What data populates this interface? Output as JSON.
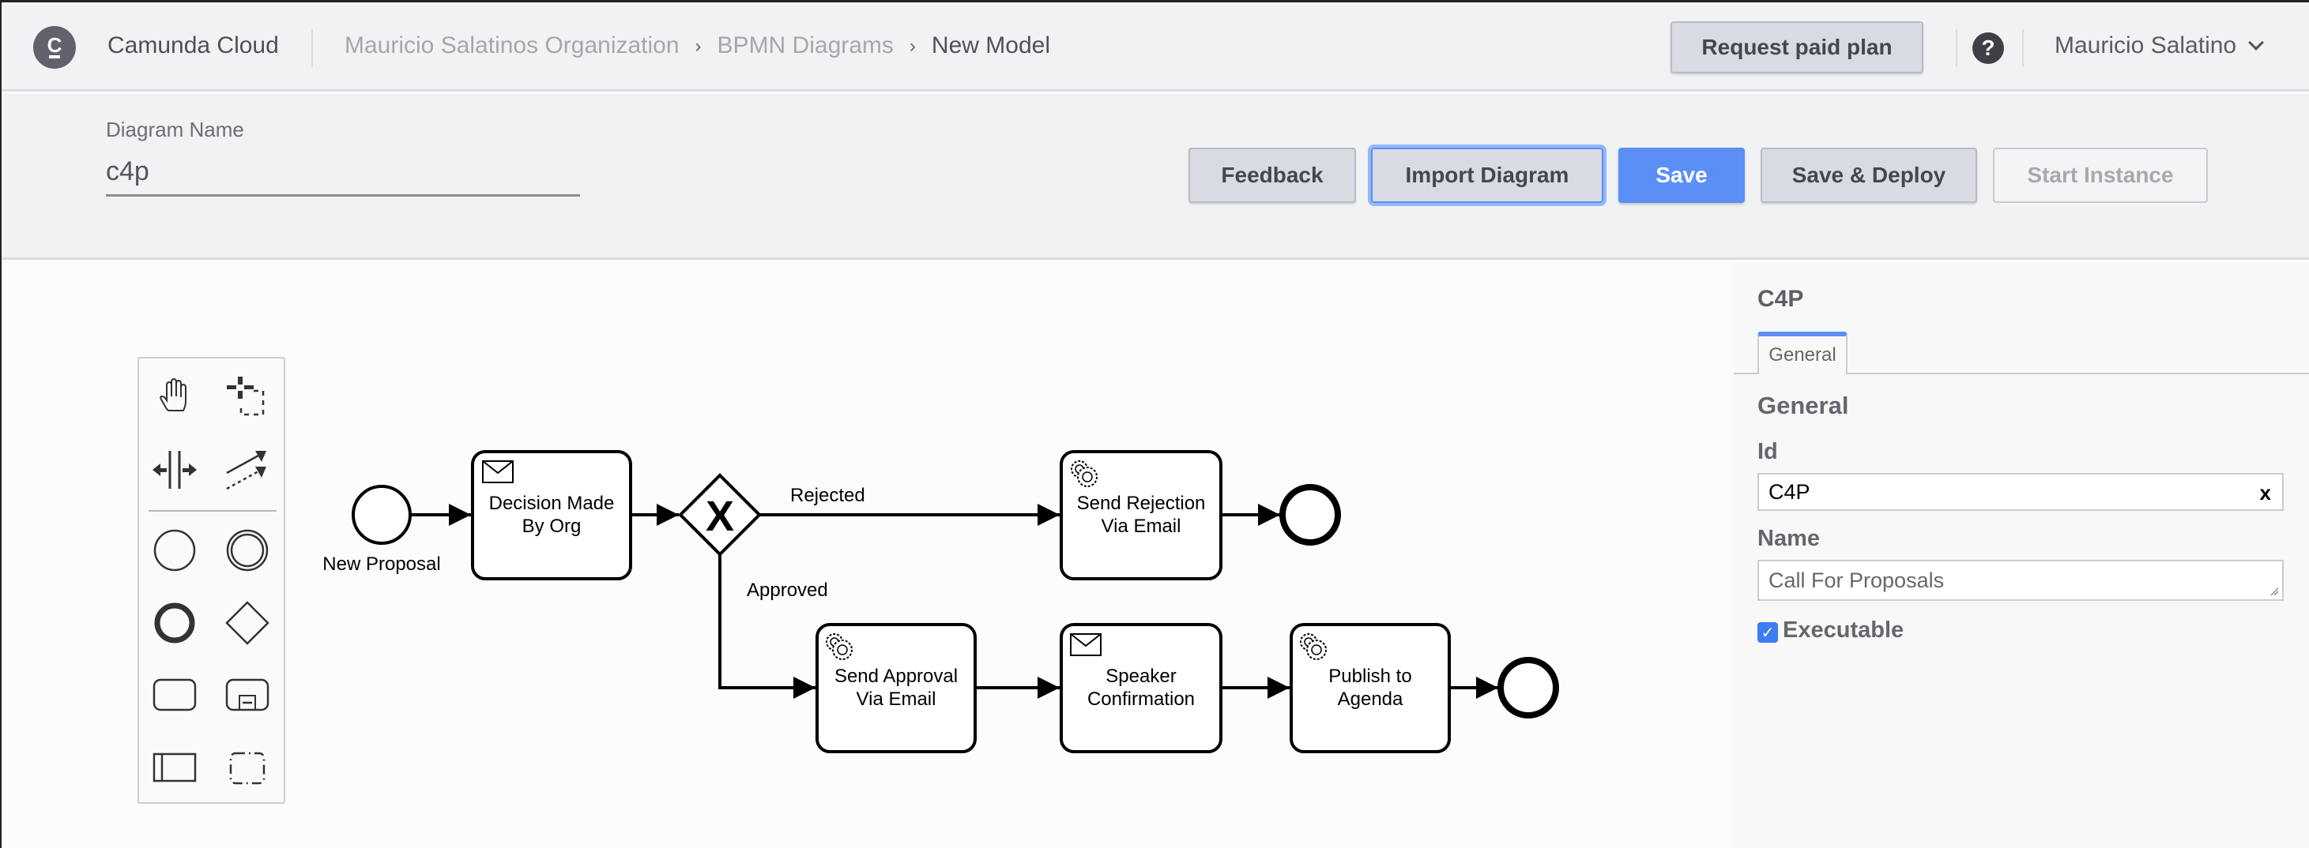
{
  "topnav": {
    "logo_letter": "C",
    "brand": "Camunda Cloud",
    "breadcrumbs": [
      "Mauricio Salatinos Organization",
      "BPMN Diagrams",
      "New Model"
    ],
    "breadcrumb_separator": "›",
    "request_plan_label": "Request paid plan",
    "help_icon": "?",
    "user_name": "Mauricio Salatino"
  },
  "toolbar": {
    "diagram_name_label": "Diagram Name",
    "diagram_name_value": "c4p",
    "buttons": {
      "feedback": "Feedback",
      "import": "Import Diagram",
      "save": "Save",
      "save_deploy": "Save & Deploy",
      "start_instance": "Start Instance"
    }
  },
  "palette": {
    "tools": [
      "hand-tool",
      "lasso-tool",
      "space-tool",
      "global-connect-tool"
    ],
    "shapes": [
      "start-event",
      "intermediate-event",
      "end-event",
      "gateway",
      "task",
      "subprocess",
      "pool",
      "group"
    ]
  },
  "diagram": {
    "start_event": {
      "label": "New Proposal"
    },
    "tasks": [
      {
        "id": "decision",
        "type": "receive",
        "lines": [
          "Decision Made",
          "By Org"
        ]
      },
      {
        "id": "rejection",
        "type": "service",
        "lines": [
          "Send Rejection",
          "Via Email"
        ]
      },
      {
        "id": "approval",
        "type": "service",
        "lines": [
          "Send Approval",
          "Via Email"
        ]
      },
      {
        "id": "speaker",
        "type": "receive",
        "lines": [
          "Speaker",
          "Confirmation"
        ]
      },
      {
        "id": "publish",
        "type": "service",
        "lines": [
          "Publish to",
          "Agenda"
        ]
      }
    ],
    "gateway": {
      "type": "exclusive",
      "marker": "X"
    },
    "flow_labels": {
      "rejected": "Rejected",
      "approved": "Approved"
    }
  },
  "properties": {
    "title": "C4P",
    "tabs": [
      "General"
    ],
    "active_tab": "General",
    "section": "General",
    "id_label": "Id",
    "id_value": "C4P",
    "clear_icon": "x",
    "name_label": "Name",
    "name_value": "Call For Proposals",
    "executable_label": "Executable",
    "executable_checked": true,
    "check_glyph": "✓"
  },
  "colors": {
    "primary": "#5b8ff5",
    "header_bg": "#f1f2f4",
    "text_dark": "#45464e"
  }
}
